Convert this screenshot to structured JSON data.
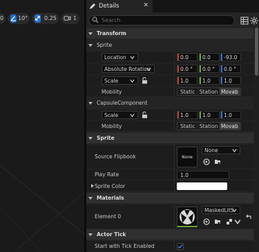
{
  "viewport": {
    "grid_value": "0",
    "rotation_snap": "10°",
    "scale_snap": "0.25",
    "camera_speed": "1"
  },
  "panel": {
    "tab_title": "Details",
    "search_placeholder": "Search"
  },
  "sections": {
    "transform": "Transform",
    "sprite_component": "Sprite",
    "capsule_component": "CapsuleComponent",
    "sprite_cat": "Sprite",
    "materials": "Materials",
    "actor_tick": "Actor Tick"
  },
  "sprite_transform": {
    "location_label": "Location",
    "location": [
      "0.0",
      "0.0",
      "-93.0"
    ],
    "rotation_label": "Absolute Rotation",
    "rotation": [
      "0.0 °",
      "0.0 °",
      "0.0 °"
    ],
    "scale_label": "Scale",
    "scale": [
      "1.0",
      "1.0",
      "1.0"
    ],
    "mobility_label": "Mobility",
    "mobility_options": [
      "Static",
      "Station",
      "Movab"
    ]
  },
  "capsule_transform": {
    "scale_label": "Scale",
    "scale": [
      "1.0",
      "1.0",
      "1.0"
    ],
    "mobility_label": "Mobility",
    "mobility_options": [
      "Static",
      "Station",
      "Movab"
    ]
  },
  "sprite_props": {
    "flipbook_label": "Source Flipbook",
    "flipbook_thumb": "None",
    "flipbook_value": "None",
    "play_rate_label": "Play Rate",
    "play_rate": "1.0",
    "sprite_color_label": "Sprite Color",
    "sprite_color": "#ffffff"
  },
  "materials": {
    "element_label": "Element 0",
    "element_value": "MaskedLitS"
  },
  "actor_tick": {
    "tick_label": "Start with Tick Enabled",
    "tick_checked": true
  },
  "colors": {
    "accent_blue": "#2c6fd0",
    "x_axis": "#c8402e",
    "y_axis": "#6aa43a",
    "z_axis": "#2c6fd0"
  }
}
